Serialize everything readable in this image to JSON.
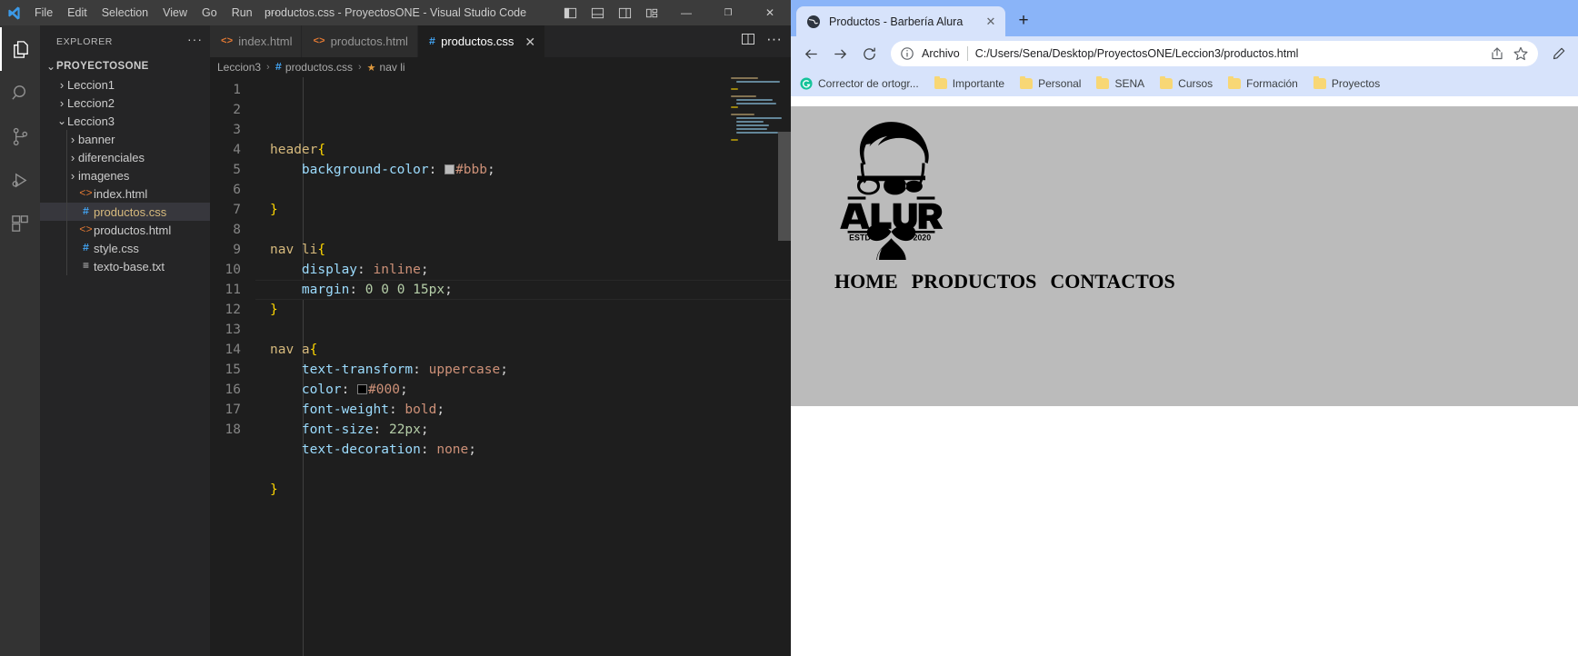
{
  "vscode": {
    "window_title": "productos.css - ProyectosONE - Visual Studio Code",
    "menu": [
      "File",
      "Edit",
      "Selection",
      "View",
      "Go",
      "Run",
      "···"
    ],
    "layout_icons": [
      "toggle-primary-sidebar-icon",
      "toggle-panel-icon",
      "toggle-secondary-sidebar-icon",
      "customize-layout-icon"
    ],
    "window_controls": {
      "minimize": "—",
      "maximize": "❐",
      "close": "✕"
    },
    "activitybar": [
      {
        "name": "explorer",
        "icon": "files-icon",
        "active": true
      },
      {
        "name": "search",
        "icon": "search-icon",
        "active": false
      },
      {
        "name": "source-control",
        "icon": "source-control-icon",
        "active": false
      },
      {
        "name": "run-and-debug",
        "icon": "run-debug-icon",
        "active": false
      },
      {
        "name": "extensions",
        "icon": "extensions-icon",
        "active": false
      }
    ],
    "sidebar": {
      "title": "EXPLORER",
      "more_actions": "···",
      "tree": [
        {
          "label": "PROYECTOSONE",
          "type": "root",
          "indent": 0,
          "expanded": true,
          "chev": "⌄"
        },
        {
          "label": "Leccion1",
          "type": "folder",
          "indent": 1,
          "expanded": false,
          "chev": "›"
        },
        {
          "label": "Leccion2",
          "type": "folder",
          "indent": 1,
          "expanded": false,
          "chev": "›"
        },
        {
          "label": "Leccion3",
          "type": "folder",
          "indent": 1,
          "expanded": true,
          "chev": "⌄"
        },
        {
          "label": "banner",
          "type": "folder",
          "indent": 2,
          "expanded": false,
          "chev": "›"
        },
        {
          "label": "diferenciales",
          "type": "folder",
          "indent": 2,
          "expanded": false,
          "chev": "›"
        },
        {
          "label": "imagenes",
          "type": "folder",
          "indent": 2,
          "expanded": false,
          "chev": "›"
        },
        {
          "label": "index.html",
          "type": "html",
          "indent": 2,
          "selected": false
        },
        {
          "label": "productos.css",
          "type": "css",
          "indent": 2,
          "selected": true
        },
        {
          "label": "productos.html",
          "type": "html",
          "indent": 2,
          "selected": false
        },
        {
          "label": "style.css",
          "type": "css",
          "indent": 2,
          "selected": false
        },
        {
          "label": "texto-base.txt",
          "type": "txt",
          "indent": 2,
          "selected": false
        }
      ]
    },
    "tabs": [
      {
        "label": "index.html",
        "type": "html",
        "active": false,
        "closable": false
      },
      {
        "label": "productos.html",
        "type": "html",
        "active": false,
        "closable": false
      },
      {
        "label": "productos.css",
        "type": "css",
        "active": true,
        "closable": true,
        "close": "✕"
      }
    ],
    "editor_actions": [
      "split-editor-icon",
      "more-actions-icon"
    ],
    "breadcrumb": [
      {
        "label": "Leccion3",
        "icon": null
      },
      {
        "label": "productos.css",
        "icon": "css-hash-icon"
      },
      {
        "label": "nav li",
        "icon": "css-selector-icon"
      }
    ],
    "breadcrumb_separator": "›",
    "code_lines": [
      {
        "n": 1,
        "tokens": [
          {
            "t": "header",
            "c": "sel"
          },
          {
            "t": "{",
            "c": "brace"
          }
        ]
      },
      {
        "n": 2,
        "indent": true,
        "highlighted": false,
        "tokens": [
          {
            "t": "    background-color",
            "c": "prop"
          },
          {
            "t": ":",
            "c": "punc"
          },
          {
            "t": " ",
            "c": "punc"
          },
          {
            "t": "SWATCH:#bbbbbb",
            "c": "swatch"
          },
          {
            "t": "#bbb",
            "c": "val"
          },
          {
            "t": ";",
            "c": "punc"
          }
        ]
      },
      {
        "n": 3,
        "indent": true,
        "tokens": []
      },
      {
        "n": 4,
        "tokens": [
          {
            "t": "}",
            "c": "brace"
          }
        ]
      },
      {
        "n": 5,
        "tokens": []
      },
      {
        "n": 6,
        "tokens": [
          {
            "t": "nav ",
            "c": "sel"
          },
          {
            "t": "li",
            "c": "sel"
          },
          {
            "t": "{",
            "c": "brace"
          }
        ]
      },
      {
        "n": 7,
        "indent": true,
        "tokens": [
          {
            "t": "    display",
            "c": "prop"
          },
          {
            "t": ":",
            "c": "punc"
          },
          {
            "t": " ",
            "c": "punc"
          },
          {
            "t": "inline",
            "c": "val"
          },
          {
            "t": ";",
            "c": "punc"
          }
        ]
      },
      {
        "n": 8,
        "indent": true,
        "highlighted": true,
        "tokens": [
          {
            "t": "    margin",
            "c": "prop"
          },
          {
            "t": ":",
            "c": "punc"
          },
          {
            "t": " ",
            "c": "punc"
          },
          {
            "t": "0 0 0 15px",
            "c": "num"
          },
          {
            "t": ";",
            "c": "punc"
          }
        ]
      },
      {
        "n": 9,
        "tokens": [
          {
            "t": "}",
            "c": "brace"
          }
        ]
      },
      {
        "n": 10,
        "tokens": []
      },
      {
        "n": 11,
        "tokens": [
          {
            "t": "nav ",
            "c": "sel"
          },
          {
            "t": "a",
            "c": "sel"
          },
          {
            "t": "{",
            "c": "brace"
          }
        ]
      },
      {
        "n": 12,
        "indent": true,
        "tokens": [
          {
            "t": "    text-transform",
            "c": "prop"
          },
          {
            "t": ":",
            "c": "punc"
          },
          {
            "t": " ",
            "c": "punc"
          },
          {
            "t": "uppercase",
            "c": "val"
          },
          {
            "t": ";",
            "c": "punc"
          }
        ]
      },
      {
        "n": 13,
        "indent": true,
        "tokens": [
          {
            "t": "    color",
            "c": "prop"
          },
          {
            "t": ":",
            "c": "punc"
          },
          {
            "t": " ",
            "c": "punc"
          },
          {
            "t": "SWATCH:#000000",
            "c": "swatch"
          },
          {
            "t": "#000",
            "c": "val"
          },
          {
            "t": ";",
            "c": "punc"
          }
        ]
      },
      {
        "n": 14,
        "indent": true,
        "tokens": [
          {
            "t": "    font-weight",
            "c": "prop"
          },
          {
            "t": ":",
            "c": "punc"
          },
          {
            "t": " ",
            "c": "punc"
          },
          {
            "t": "bold",
            "c": "val"
          },
          {
            "t": ";",
            "c": "punc"
          }
        ]
      },
      {
        "n": 15,
        "indent": true,
        "tokens": [
          {
            "t": "    font-size",
            "c": "prop"
          },
          {
            "t": ":",
            "c": "punc"
          },
          {
            "t": " ",
            "c": "punc"
          },
          {
            "t": "22px",
            "c": "num"
          },
          {
            "t": ";",
            "c": "punc"
          }
        ]
      },
      {
        "n": 16,
        "indent": true,
        "tokens": [
          {
            "t": "    text-decoration",
            "c": "prop"
          },
          {
            "t": ":",
            "c": "punc"
          },
          {
            "t": " ",
            "c": "punc"
          },
          {
            "t": "none",
            "c": "val"
          },
          {
            "t": ";",
            "c": "punc"
          }
        ]
      },
      {
        "n": 17,
        "indent": true,
        "tokens": []
      },
      {
        "n": 18,
        "tokens": [
          {
            "t": "}",
            "c": "brace"
          }
        ]
      }
    ],
    "colors": {
      "editor_bg": "#1e1e1e",
      "sidebar_bg": "#252526",
      "activitybar_bg": "#333333",
      "titlebar_bg": "#3c3c3c"
    }
  },
  "chrome": {
    "tab": {
      "title": "Productos - Barbería Alura",
      "favicon": "globe-icon",
      "close": "✕"
    },
    "new_tab_label": "+",
    "nav": {
      "back": "←",
      "forward": "→",
      "reload": "↻"
    },
    "omnibox": {
      "info_icon": "info-circle-icon",
      "scheme_label": "Archivo",
      "url": "C:/Users/Sena/Desktop/ProyectosONE/Leccion3/productos.html",
      "share_icon": "share-icon",
      "star_icon": "star-icon"
    },
    "toolbar_icons": [
      "pencil-icon"
    ],
    "bookmarks": [
      {
        "label": "Corrector de ortogr...",
        "icon": "grammarly-icon"
      },
      {
        "label": "Importante",
        "icon": "folder-icon"
      },
      {
        "label": "Personal",
        "icon": "folder-icon"
      },
      {
        "label": "SENA",
        "icon": "folder-icon"
      },
      {
        "label": "Cursos",
        "icon": "folder-icon"
      },
      {
        "label": "Formación",
        "icon": "folder-icon"
      },
      {
        "label": "Proyectos",
        "icon": "folder-icon"
      }
    ],
    "page": {
      "header_bg": "#bbbbbb",
      "logo": {
        "name": "alura-barber-logo",
        "wordmark": "ALURA",
        "estd": "ESTD",
        "year": "2020"
      },
      "nav_links": [
        "HOME",
        "PRODUCTOS",
        "CONTACTOS"
      ]
    }
  }
}
